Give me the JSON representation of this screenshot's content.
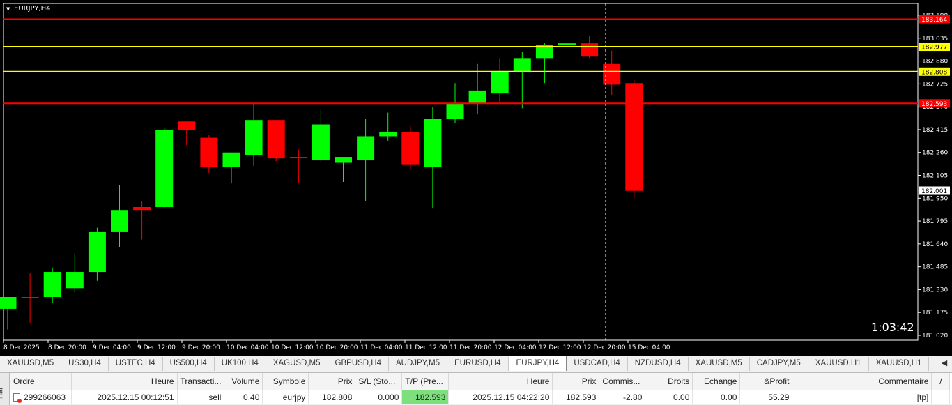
{
  "chart": {
    "symbol_label": "EURJPY,H4",
    "timer": "1:03:42",
    "colors": {
      "background": "#000000",
      "bull": "#00ff00",
      "bear": "#ff0000",
      "doji": "#00ff00",
      "axis_text": "#ffffff",
      "sl_line": "#ff0000",
      "entry_line": "#ffff00"
    },
    "price_ticks": [
      "183.190",
      "183.035",
      "182.880",
      "182.725",
      "182.570",
      "182.415",
      "182.260",
      "182.105",
      "181.950",
      "181.795",
      "181.640",
      "181.485",
      "181.330",
      "181.175",
      "181.020"
    ],
    "time_ticks": [
      "8 Dec 2025",
      "8 Dec 20:00",
      "9 Dec 04:00",
      "9 Dec 12:00",
      "9 Dec 20:00",
      "10 Dec 04:00",
      "10 Dec 12:00",
      "10 Dec 20:00",
      "11 Dec 04:00",
      "11 Dec 12:00",
      "11 Dec 20:00",
      "12 Dec 04:00",
      "12 Dec 12:00",
      "12 Dec 20:00",
      "15 Dec 04:00"
    ],
    "levels": [
      {
        "price": 183.164,
        "label": "183.164",
        "color": "#ff0000",
        "label_bg": "#ff0000",
        "label_fg": "#ffffff"
      },
      {
        "price": 182.977,
        "label": "182.977",
        "color": "#ffff00",
        "label_bg": "#ffff00",
        "label_fg": "#000000"
      },
      {
        "price": 182.808,
        "label": "182.808",
        "color": "#ffff00",
        "label_bg": "#ffff00",
        "label_fg": "#000000"
      },
      {
        "price": 182.593,
        "label": "182.593",
        "color": "#ff0000",
        "label_bg": "#ff0000",
        "label_fg": "#ffffff"
      }
    ],
    "current_price_label": "182.001"
  },
  "chart_data": {
    "type": "candlestick",
    "title": "EURJPY,H4",
    "ylim": [
      181.02,
      183.19
    ],
    "candles": [
      {
        "o": 181.2,
        "h": 181.24,
        "l": 181.06,
        "c": 181.28
      },
      {
        "o": 181.28,
        "h": 181.44,
        "l": 181.1,
        "c": 181.28
      },
      {
        "o": 181.28,
        "h": 181.48,
        "l": 181.24,
        "c": 181.45
      },
      {
        "o": 181.34,
        "h": 181.57,
        "l": 181.31,
        "c": 181.45
      },
      {
        "o": 181.45,
        "h": 181.75,
        "l": 181.39,
        "c": 181.72
      },
      {
        "o": 181.72,
        "h": 182.04,
        "l": 181.62,
        "c": 181.87
      },
      {
        "o": 181.89,
        "h": 181.93,
        "l": 181.67,
        "c": 181.87
      },
      {
        "o": 181.89,
        "h": 182.43,
        "l": 181.88,
        "c": 182.41
      },
      {
        "o": 182.47,
        "h": 182.47,
        "l": 182.31,
        "c": 182.41
      },
      {
        "o": 182.36,
        "h": 182.38,
        "l": 182.12,
        "c": 182.16
      },
      {
        "o": 182.16,
        "h": 182.26,
        "l": 182.05,
        "c": 182.26
      },
      {
        "o": 182.24,
        "h": 182.6,
        "l": 182.17,
        "c": 182.48
      },
      {
        "o": 182.48,
        "h": 182.48,
        "l": 182.2,
        "c": 182.22
      },
      {
        "o": 182.23,
        "h": 182.28,
        "l": 182.05,
        "c": 182.23
      },
      {
        "o": 182.21,
        "h": 182.55,
        "l": 182.2,
        "c": 182.45
      },
      {
        "o": 182.19,
        "h": 182.22,
        "l": 182.06,
        "c": 182.23
      },
      {
        "o": 182.21,
        "h": 182.49,
        "l": 181.93,
        "c": 182.37
      },
      {
        "o": 182.37,
        "h": 182.53,
        "l": 182.34,
        "c": 182.4
      },
      {
        "o": 182.4,
        "h": 182.44,
        "l": 182.14,
        "c": 182.18
      },
      {
        "o": 182.16,
        "h": 182.57,
        "l": 181.88,
        "c": 182.49
      },
      {
        "o": 182.49,
        "h": 182.73,
        "l": 182.46,
        "c": 182.59
      },
      {
        "o": 182.59,
        "h": 182.86,
        "l": 182.52,
        "c": 182.68
      },
      {
        "o": 182.66,
        "h": 182.9,
        "l": 182.6,
        "c": 182.81
      },
      {
        "o": 182.81,
        "h": 182.94,
        "l": 182.56,
        "c": 182.9
      },
      {
        "o": 182.9,
        "h": 183.0,
        "l": 182.73,
        "c": 182.99
      },
      {
        "o": 182.99,
        "h": 183.17,
        "l": 182.7,
        "c": 183.0
      },
      {
        "o": 183.0,
        "h": 183.05,
        "l": 182.9,
        "c": 182.91
      },
      {
        "o": 182.86,
        "h": 182.95,
        "l": 182.65,
        "c": 182.72
      },
      {
        "o": 182.73,
        "h": 182.75,
        "l": 181.95,
        "c": 182.0
      }
    ]
  },
  "tabs": [
    {
      "label": "XAUUSD,M5"
    },
    {
      "label": "US30,H4"
    },
    {
      "label": "USTEC,H4"
    },
    {
      "label": "US500,H4"
    },
    {
      "label": "UK100,H4"
    },
    {
      "label": "XAGUSD,M5"
    },
    {
      "label": "GBPUSD,H4"
    },
    {
      "label": "AUDJPY,M5"
    },
    {
      "label": "EURUSD,H4"
    },
    {
      "label": "EURJPY,H4"
    },
    {
      "label": "USDCAD,H4"
    },
    {
      "label": "NZDUSD,H4"
    },
    {
      "label": "XAUUSD,M5"
    },
    {
      "label": "CADJPY,M5"
    },
    {
      "label": "XAUUSD,H1"
    },
    {
      "label": "XAUUSD,H1"
    }
  ],
  "tab_arrow": "◀",
  "terminal": {
    "side_label": "inal",
    "headers": [
      "Ordre",
      "Heure",
      "Transacti...",
      "Volume",
      "Symbole",
      "Prix",
      "S/L (Sto...",
      "T/P (Pre...",
      "Heure",
      "Prix",
      "Commis...",
      "Droits",
      "Echange",
      "&Profit",
      "Commentaire",
      "/"
    ],
    "row": [
      "299266063",
      "2025.12.15 00:12:51",
      "sell",
      "0.40",
      "eurjpy",
      "182.808",
      "0.000",
      "182.593",
      "2025.12.15 04:22:20",
      "182.593",
      "-2.80",
      "0.00",
      "0.00",
      "55.29",
      "[tp]"
    ]
  }
}
